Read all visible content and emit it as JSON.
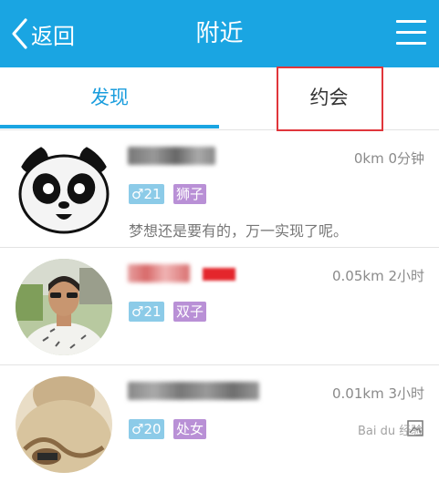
{
  "header": {
    "back_label": "返回",
    "title": "附近",
    "colors": {
      "bar": "#1aa5e2"
    }
  },
  "tabs": [
    {
      "label": "发现",
      "active": true
    },
    {
      "label": "约会",
      "active": false,
      "highlighted": true
    }
  ],
  "people": [
    {
      "avatar": "panda-avatar",
      "distance_time": "0km 0分钟",
      "gender": "♂21",
      "zodiac": "狮子",
      "signature": "梦想还是要有的，万一实现了呢。"
    },
    {
      "avatar": "man-photo-avatar",
      "distance_time": "0.05km 2小时",
      "gender": "♂21",
      "zodiac": "双子",
      "signature": ""
    },
    {
      "avatar": "sweater-photo-avatar",
      "distance_time": "0.01km 3小时",
      "gender": "♂20",
      "zodiac": "处女",
      "signature": ""
    }
  ],
  "watermark": "Bai du 经验"
}
